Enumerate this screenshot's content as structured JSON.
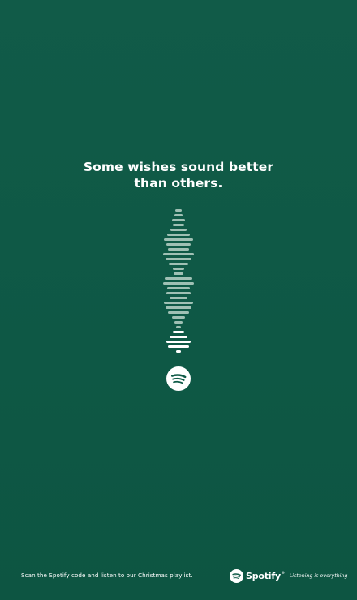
{
  "headline": {
    "line1": "Some wishes sound better",
    "line2": "than others."
  },
  "code": {
    "icon": "spotify-code-tree-icon",
    "color_dim": "#9fc0b4",
    "color_bright": "#ffffff"
  },
  "center_logo": {
    "icon": "spotify-logo-icon"
  },
  "footer": {
    "instruction": "Scan the Spotify code and listen to our Christmas playlist.",
    "brand_name": "Spotify",
    "trademark": "®",
    "tagline": "Listening is everything"
  },
  "colors": {
    "background": "#0f5a47",
    "text": "#ffffff"
  }
}
